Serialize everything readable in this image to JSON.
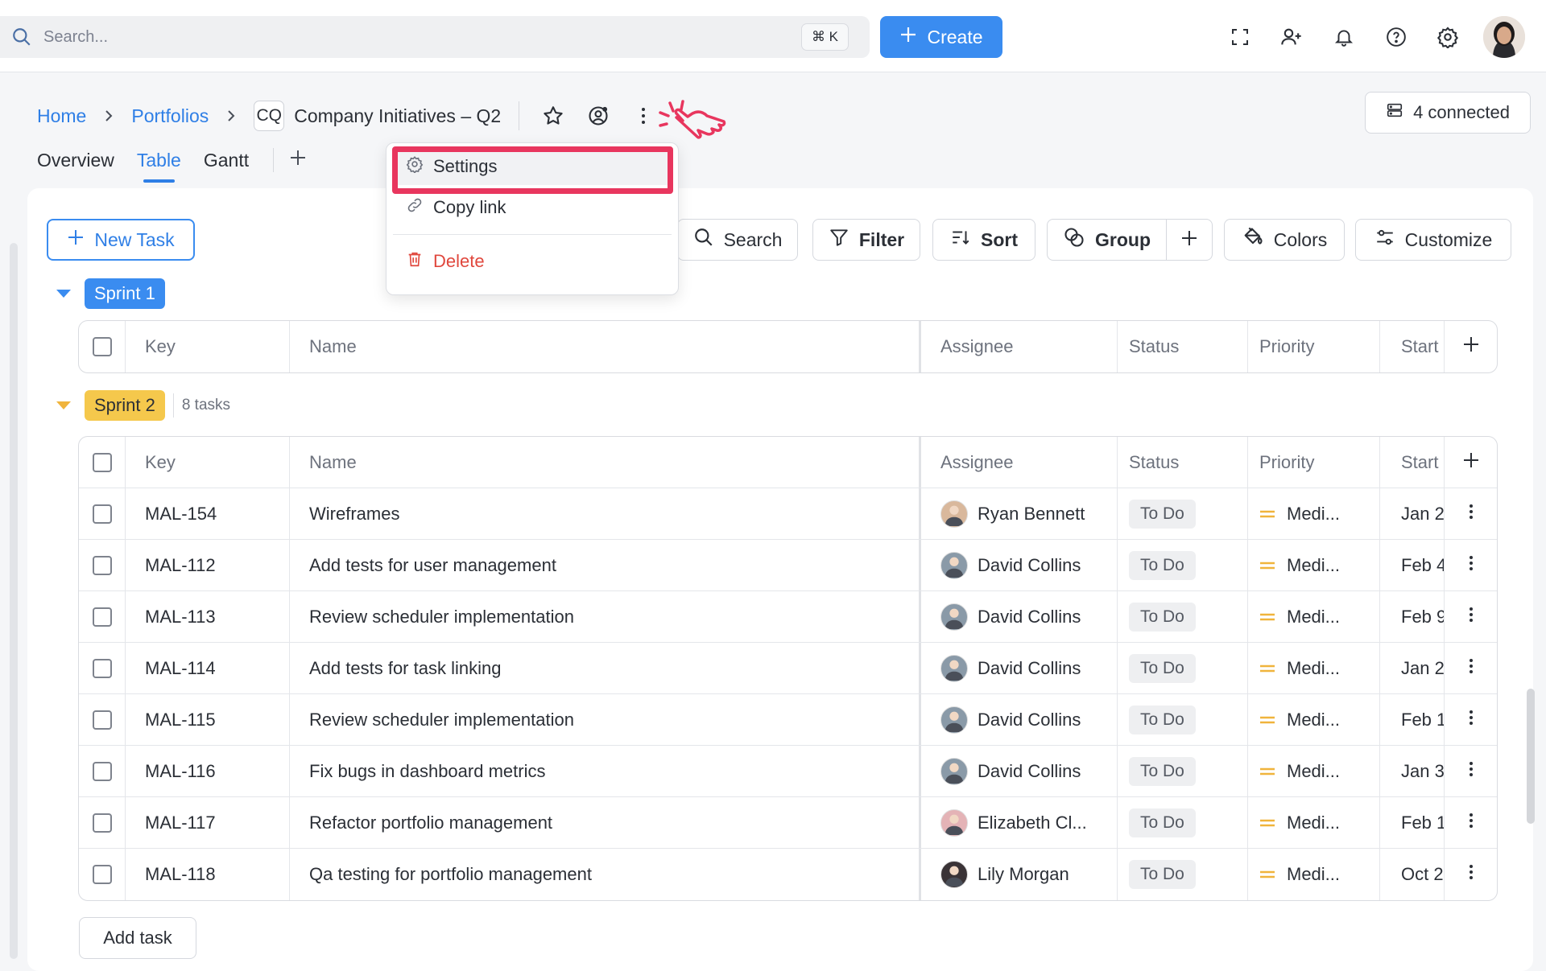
{
  "topbar": {
    "search_placeholder": "Search...",
    "shortcut": "⌘ K",
    "create_label": "Create",
    "icons": [
      "fullscreen-icon",
      "add-user-icon",
      "bell-icon",
      "help-icon",
      "gear-icon"
    ]
  },
  "breadcrumb": {
    "home": "Home",
    "portfolios": "Portfolios",
    "badge": "CQ",
    "title": "Company Initiatives – Q2"
  },
  "connected_label": "4 connected",
  "tabs": [
    {
      "label": "Overview",
      "active": false
    },
    {
      "label": "Table",
      "active": true
    },
    {
      "label": "Gantt",
      "active": false
    }
  ],
  "toolbar": {
    "new_task": "New Task",
    "search": "Search",
    "filter": "Filter",
    "sort": "Sort",
    "group": "Group",
    "colors": "Colors",
    "customize": "Customize"
  },
  "menu": {
    "settings": "Settings",
    "copy_link": "Copy link",
    "delete": "Delete"
  },
  "sprint1": {
    "label": "Sprint 1",
    "color": "#3a8cf0"
  },
  "sprint2": {
    "label": "Sprint 2",
    "count": "8 tasks",
    "color": "#f5c84c"
  },
  "columns": {
    "key": "Key",
    "name": "Name",
    "assignee": "Assignee",
    "status": "Status",
    "priority": "Priority",
    "start": "Start"
  },
  "rows": [
    {
      "key": "MAL-154",
      "name": "Wireframes",
      "assignee": "Ryan Bennett",
      "status": "To Do",
      "priority": "Medi...",
      "start": "Jan 2"
    },
    {
      "key": "MAL-112",
      "name": "Add tests for user management",
      "assignee": "David Collins",
      "status": "To Do",
      "priority": "Medi...",
      "start": "Feb 4"
    },
    {
      "key": "MAL-113",
      "name": "Review scheduler implementation",
      "assignee": "David Collins",
      "status": "To Do",
      "priority": "Medi...",
      "start": "Feb 9"
    },
    {
      "key": "MAL-114",
      "name": "Add tests for task linking",
      "assignee": "David Collins",
      "status": "To Do",
      "priority": "Medi...",
      "start": "Jan 2"
    },
    {
      "key": "MAL-115",
      "name": "Review scheduler implementation",
      "assignee": "David Collins",
      "status": "To Do",
      "priority": "Medi...",
      "start": "Feb 1"
    },
    {
      "key": "MAL-116",
      "name": "Fix bugs in dashboard metrics",
      "assignee": "David Collins",
      "status": "To Do",
      "priority": "Medi...",
      "start": "Jan 3"
    },
    {
      "key": "MAL-117",
      "name": "Refactor portfolio management",
      "assignee": "Elizabeth Cl...",
      "status": "To Do",
      "priority": "Medi...",
      "start": "Feb 1"
    },
    {
      "key": "MAL-118",
      "name": "Qa testing for portfolio management",
      "assignee": "Lily Morgan",
      "status": "To Do",
      "priority": "Medi...",
      "start": "Oct 2"
    }
  ],
  "add_task": "Add task",
  "colors": {
    "accent": "#3a8cf0",
    "highlight": "#e8365e",
    "priority_medium": "#f0b43c",
    "delete": "#e0473d"
  }
}
